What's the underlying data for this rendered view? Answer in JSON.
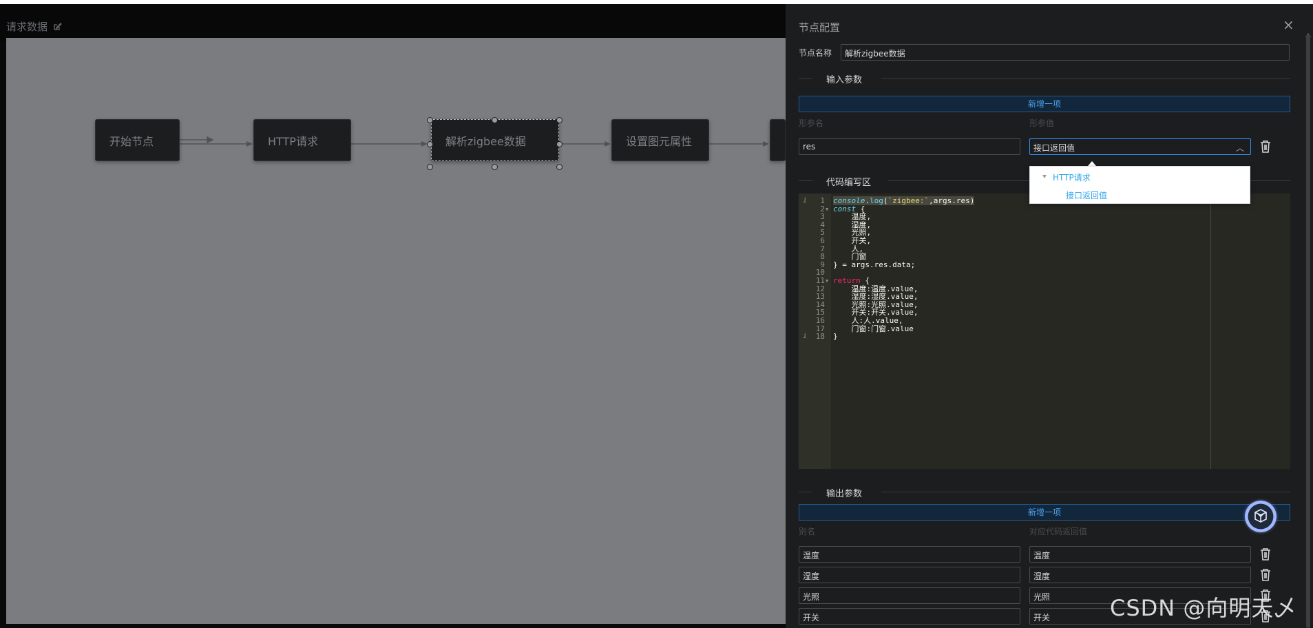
{
  "header": {
    "title": "请求数据"
  },
  "flow": {
    "nodes": [
      "开始节点",
      "HTTP请求",
      "解析zigbee数据",
      "设置图元属性"
    ]
  },
  "panel": {
    "title": "节点配置",
    "node_name_label": "节点名称",
    "node_name_value": "解析zigbee数据",
    "input_section": "输入参数",
    "add_label": "新增一项",
    "param_name_header": "形参名",
    "param_value_header": "形参值",
    "input_param_name": "res",
    "input_param_value": "接口返回值",
    "code_section": "代码编写区",
    "output_section": "输出参数",
    "alias_header": "别名",
    "return_header": "对应代码返回值",
    "outputs": [
      {
        "alias": "温度",
        "value": "温度"
      },
      {
        "alias": "湿度",
        "value": "湿度"
      },
      {
        "alias": "光照",
        "value": "光照"
      },
      {
        "alias": "开关",
        "value": "开关"
      }
    ]
  },
  "dropdown": {
    "group": "HTTP请求",
    "option": "接口返回值"
  },
  "code": {
    "line_numbers": [
      "1",
      "2",
      "3",
      "4",
      "5",
      "6",
      "7",
      "8",
      "9",
      "10",
      "11",
      "12",
      "13",
      "14",
      "15",
      "16",
      "17",
      "18"
    ],
    "lines": [
      "",
      "",
      "    温度,",
      "    湿度,",
      "    光照,",
      "    开关,",
      "    人,",
      "    门窗",
      "} = args.res.data;",
      "",
      "",
      "    温度:温度.value,",
      "    湿度:湿度.value,",
      "    光照:光照.value,",
      "    开关:开关.value,",
      "    人:人.value,",
      "    门窗:门窗.value",
      "}"
    ],
    "line1_parts": [
      "console",
      ".",
      "log",
      "(",
      "`zigbee:`",
      ",args.res)"
    ],
    "line2_parts": [
      "const",
      " {"
    ],
    "line11_parts": [
      "return",
      " {"
    ]
  },
  "watermark": "CSDN @向明天乄"
}
